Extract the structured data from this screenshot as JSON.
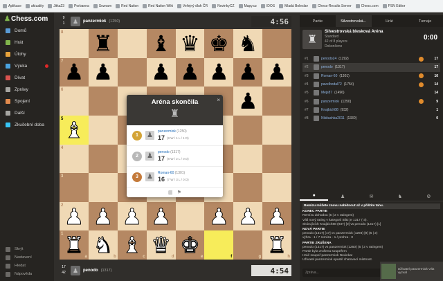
{
  "bookmarks": [
    "Aplikace",
    "aktuality",
    "Jitka23",
    "Porbanna",
    "Seznam",
    "Red Nation",
    "Red Nation Wiki",
    "Veřejný dluh ČR",
    "NovinkyCZ",
    "Mapy.cz",
    "IDOS",
    "Mladá Boleslav",
    "Chess-Results Server",
    "Chess.com",
    "PSN Editor"
  ],
  "sidebar": {
    "logo": "Chess.com",
    "items": [
      {
        "label": "Domů",
        "icon": "home-icon",
        "color": "#5a9bd5"
      },
      {
        "label": "Hrát",
        "icon": "play-icon",
        "color": "#81b64c"
      },
      {
        "label": "Úlohy",
        "icon": "puzzle-icon",
        "color": "#e8a33b"
      },
      {
        "label": "Výuka",
        "icon": "learn-icon",
        "color": "#4aa3df",
        "badge": true
      },
      {
        "label": "Dívat",
        "icon": "watch-icon",
        "color": "#d9534f"
      },
      {
        "label": "Zprávy",
        "icon": "news-icon",
        "color": "#a7a6a2"
      },
      {
        "label": "Spojení",
        "icon": "social-icon",
        "color": "#e38b4d"
      },
      {
        "label": "Další",
        "icon": "more-icon",
        "color": "#a7a6a2"
      },
      {
        "label": "Zkušební doba",
        "icon": "diamond-icon",
        "color": "#37c4f4"
      }
    ],
    "bottom": [
      "Skrýt",
      "Nastavení",
      "Hledat",
      "Nápověda"
    ]
  },
  "top_player": {
    "score_top": "9",
    "score_bottom": "1",
    "name": "panzermiok",
    "rating": "(1250)",
    "clock": "4:56"
  },
  "bottom_player": {
    "score_top": "17",
    "score_bottom": "42",
    "name": "penodo",
    "rating": "(1317)",
    "clock": "4:54"
  },
  "board": {
    "ranks": [
      "8",
      "7",
      "6",
      "5",
      "4",
      "3",
      "2",
      "1"
    ],
    "files": [
      "a",
      "b",
      "c",
      "d",
      "e",
      "f",
      "g",
      "h"
    ],
    "rows": [
      [
        "",
        "r",
        "",
        "b",
        "q",
        "k",
        "n",
        ""
      ],
      [
        "p",
        "p",
        "",
        "p",
        "p",
        "p",
        "p",
        "p"
      ],
      [
        "",
        "",
        "",
        "",
        "",
        "",
        "p",
        ""
      ],
      [
        "B",
        "",
        "",
        "",
        "",
        "",
        "",
        ""
      ],
      [
        "",
        "",
        "",
        "",
        "",
        "",
        "",
        ""
      ],
      [
        "",
        "",
        "",
        "",
        "",
        "",
        "",
        ""
      ],
      [
        "P",
        "P",
        "P",
        "P",
        "",
        "P",
        "P",
        "P"
      ],
      [
        "R",
        "N",
        "B",
        "Q",
        "K",
        "",
        "",
        "R"
      ]
    ],
    "highlights": [
      "a5",
      "f1"
    ]
  },
  "modal": {
    "title": "Aréna skončila",
    "close": "×",
    "results": [
      {
        "medal": "1",
        "medal_color": "#d4a437",
        "name": "panzermiok",
        "rating": "(1250)",
        "score": "17",
        "detail": "(8 W / 1 L / 1 D)"
      },
      {
        "medal": "2",
        "medal_color": "#b8b8b8",
        "name": "penodo",
        "rating": "(1317)",
        "score": "17",
        "detail": "(8 W / 2 L / 0 D)"
      },
      {
        "medal": "3",
        "medal_color": "#c47a3a",
        "name": "Roman-60",
        "rating": "(1301)",
        "score": "16",
        "detail": "(7 W / 3 L / 0 D)"
      }
    ]
  },
  "right_panel": {
    "tabs": [
      "Partie",
      "Silvestrovská...",
      "Hrát",
      "Turnaje"
    ],
    "arena": {
      "name": "Silvestrovská blesková Aréna",
      "type": "Standard",
      "players": "42 of 8 players",
      "status": "Dokončeno",
      "time": "0:00"
    },
    "standings": [
      {
        "rank": "#1",
        "name": "penodo24",
        "rating": "(1292)",
        "score": "17",
        "fire": true
      },
      {
        "rank": "#2",
        "name": "penodo",
        "rating": "(1317)",
        "score": "17",
        "fire": false,
        "me": true
      },
      {
        "rank": "#3",
        "name": "Roman-60",
        "rating": "(1301)",
        "score": "16",
        "fire": true
      },
      {
        "rank": "#4",
        "name": "pavelbodal72",
        "rating": "(1754)",
        "score": "14",
        "fire": true
      },
      {
        "rank": "#5",
        "name": "Mejs87",
        "rating": "(1496)",
        "score": "14",
        "fire": false
      },
      {
        "rank": "#6",
        "name": "panzermiok",
        "rating": "(1250)",
        "score": "9",
        "fire": true
      },
      {
        "rank": "#7",
        "name": "Knajbich88",
        "rating": "(932)",
        "score": "1",
        "fire": false
      },
      {
        "rank": "#8",
        "name": "Nikitushka2011",
        "rating": "(1330)",
        "score": "0",
        "fire": false
      }
    ],
    "chat": [
      {
        "cls": "hl",
        "text": "Remízu můžete znovu nabídnout až v příštím tahu."
      },
      {
        "cls": "hdr",
        "text": "KONEC PARTIE"
      },
      {
        "cls": "",
        "text": "Remízu dohodou (5 | 2 v ratingem)"
      },
      {
        "cls": "",
        "text": "Váš nový rating v kategorii Blitz je 1317 (-3)."
      },
      {
        "cls": "",
        "text": "Skórujících Knajbich88 (937) [0] vs penodo (1317) [1]"
      },
      {
        "cls": "hdr",
        "text": "NOVÁ PARTIE"
      },
      {
        "cls": "",
        "text": "penodo (1317) [17] vs panzermiok (1293) [9] (5 | 2)"
      },
      {
        "cls": "",
        "text": "výhra - 1 / 7 remíza - 1 / prohra - 0"
      },
      {
        "cls": "hdr",
        "text": "PARTIE ZRUŠENA"
      },
      {
        "cls": "",
        "text": "penodo (1317) vs panzermiok (1250) (5 | 2 v ratingem)"
      },
      {
        "cls": "",
        "text": "Partie byla zrušena soupeřem"
      },
      {
        "cls": "",
        "text": "Hráč soupeř panzermiok Novinka!"
      },
      {
        "cls": "",
        "text": "Uživatel panzermiok opustil chatovací místnost."
      }
    ],
    "chat_placeholder": "Zpráva..."
  },
  "notification": {
    "text": "Uživatel panzermiok Vás vyzval"
  }
}
